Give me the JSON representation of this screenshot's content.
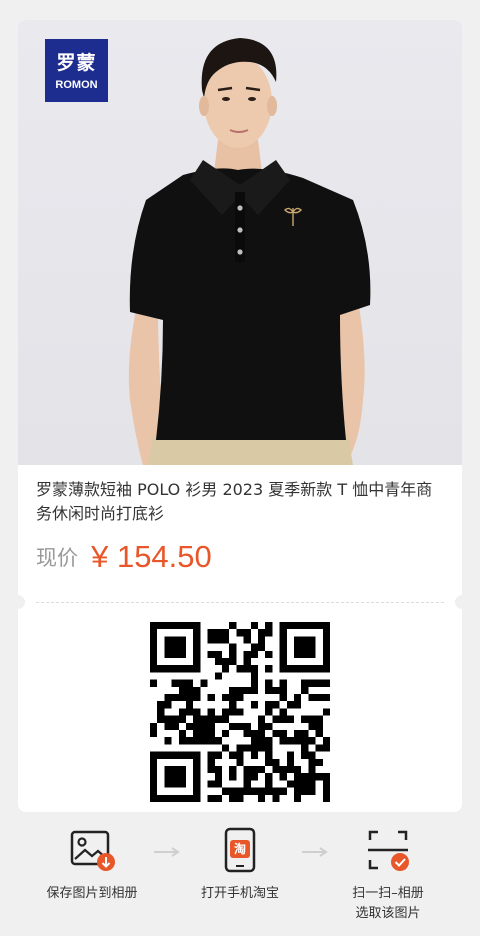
{
  "brand": {
    "name_cn": "罗蒙",
    "name_en": "ROMON"
  },
  "product": {
    "title": "罗蒙薄款短袖 POLO 衫男 2023 夏季新款 T 恤中青年商务休闲时尚打底衫",
    "price_label": "现价",
    "price": "¥ 154.50"
  },
  "actions": [
    {
      "label": "保存图片到相册",
      "icon": "save-image-icon"
    },
    {
      "label": "打开手机淘宝",
      "icon": "taobao-phone-icon",
      "badge": "淘"
    },
    {
      "label": "扫一扫–相册\n选取该图片",
      "icon": "scan-icon"
    }
  ],
  "colors": {
    "accent": "#e8572a",
    "brand": "#1d2c8f"
  }
}
